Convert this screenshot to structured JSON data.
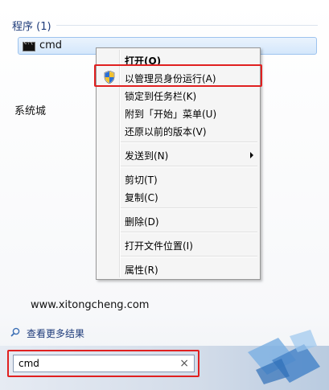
{
  "start_menu": {
    "group_header": "程序 (1)",
    "result_label": "cmd",
    "side_text": "系统城",
    "watermark_url": "www.xitongcheng.com",
    "more_results": "查看更多结果",
    "search_value": "cmd",
    "search_clear": "×"
  },
  "context_menu": {
    "open": "打开(O)",
    "run_as_admin": "以管理员身份运行(A)",
    "pin_taskbar": "锁定到任务栏(K)",
    "pin_start": "附到「开始」菜单(U)",
    "restore": "还原以前的版本(V)",
    "send_to": "发送到(N)",
    "cut": "剪切(T)",
    "copy": "复制(C)",
    "delete": "删除(D)",
    "open_location": "打开文件位置(I)",
    "properties": "属性(R)"
  },
  "colors": {
    "highlight_box": "#e02020",
    "header_text": "#1e3b7a"
  }
}
